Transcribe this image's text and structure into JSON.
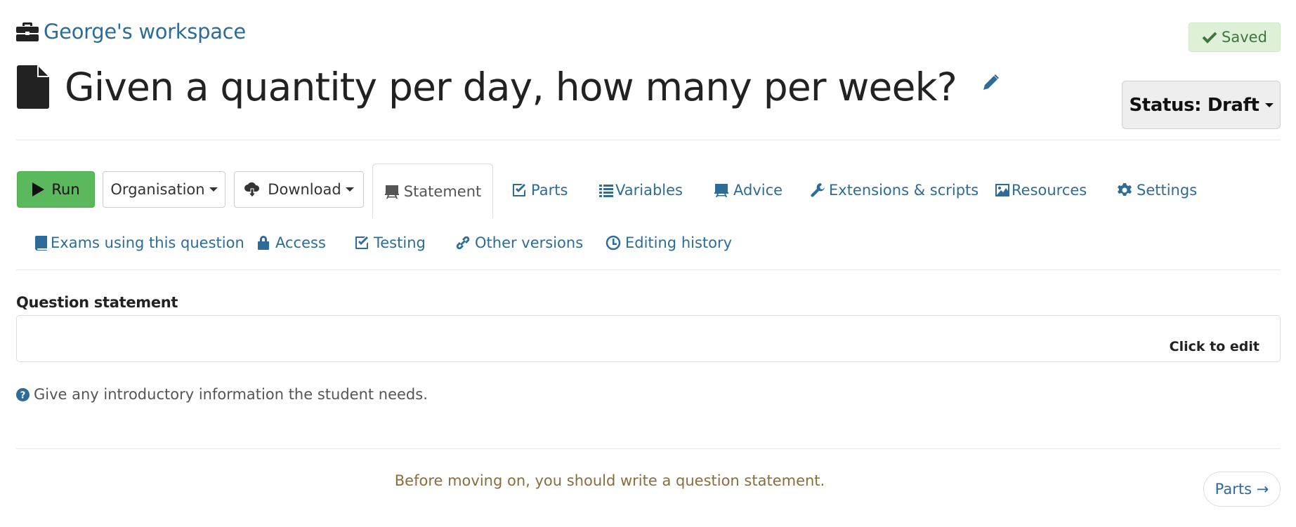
{
  "header": {
    "workspace_label": "George's workspace",
    "workspace_icon": "briefcase-icon",
    "saved_label": "Saved",
    "saved_icon": "check-icon",
    "title": "Given a quantity per day, how many per week?",
    "title_icon": "file-icon",
    "edit_icon": "pencil-icon",
    "status_label": "Status: Draft"
  },
  "toolbar": {
    "run_label": "Run",
    "organisation_label": "Organisation",
    "download_label": "Download"
  },
  "tabs": [
    {
      "label": "Statement",
      "icon": "blackboard-icon",
      "active": true
    },
    {
      "label": "Parts",
      "icon": "check-square-icon"
    },
    {
      "label": "Variables",
      "icon": "list-icon"
    },
    {
      "label": "Advice",
      "icon": "blackboard-icon"
    },
    {
      "label": "Extensions & scripts",
      "icon": "wrench-icon"
    },
    {
      "label": "Resources",
      "icon": "picture-icon"
    },
    {
      "label": "Settings",
      "icon": "gear-icon"
    },
    {
      "label": "Exams using this question",
      "icon": "book-icon"
    },
    {
      "label": "Access",
      "icon": "lock-icon"
    },
    {
      "label": "Testing",
      "icon": "check-square-icon"
    },
    {
      "label": "Other versions",
      "icon": "link-icon"
    },
    {
      "label": "Editing history",
      "icon": "clock-icon"
    }
  ],
  "content": {
    "section_label": "Question statement",
    "editor_hint": "Click to edit",
    "help_text": "Give any introductory information the student needs.",
    "warning": "Before moving on, you should write a question statement.",
    "next_label": "Parts →"
  },
  "colors": {
    "link": "#2d6b99",
    "run_green": "#5cb85c",
    "saved_bg": "#dff0d8",
    "saved_text": "#3c763d",
    "warning_text": "#8a6d3b"
  }
}
